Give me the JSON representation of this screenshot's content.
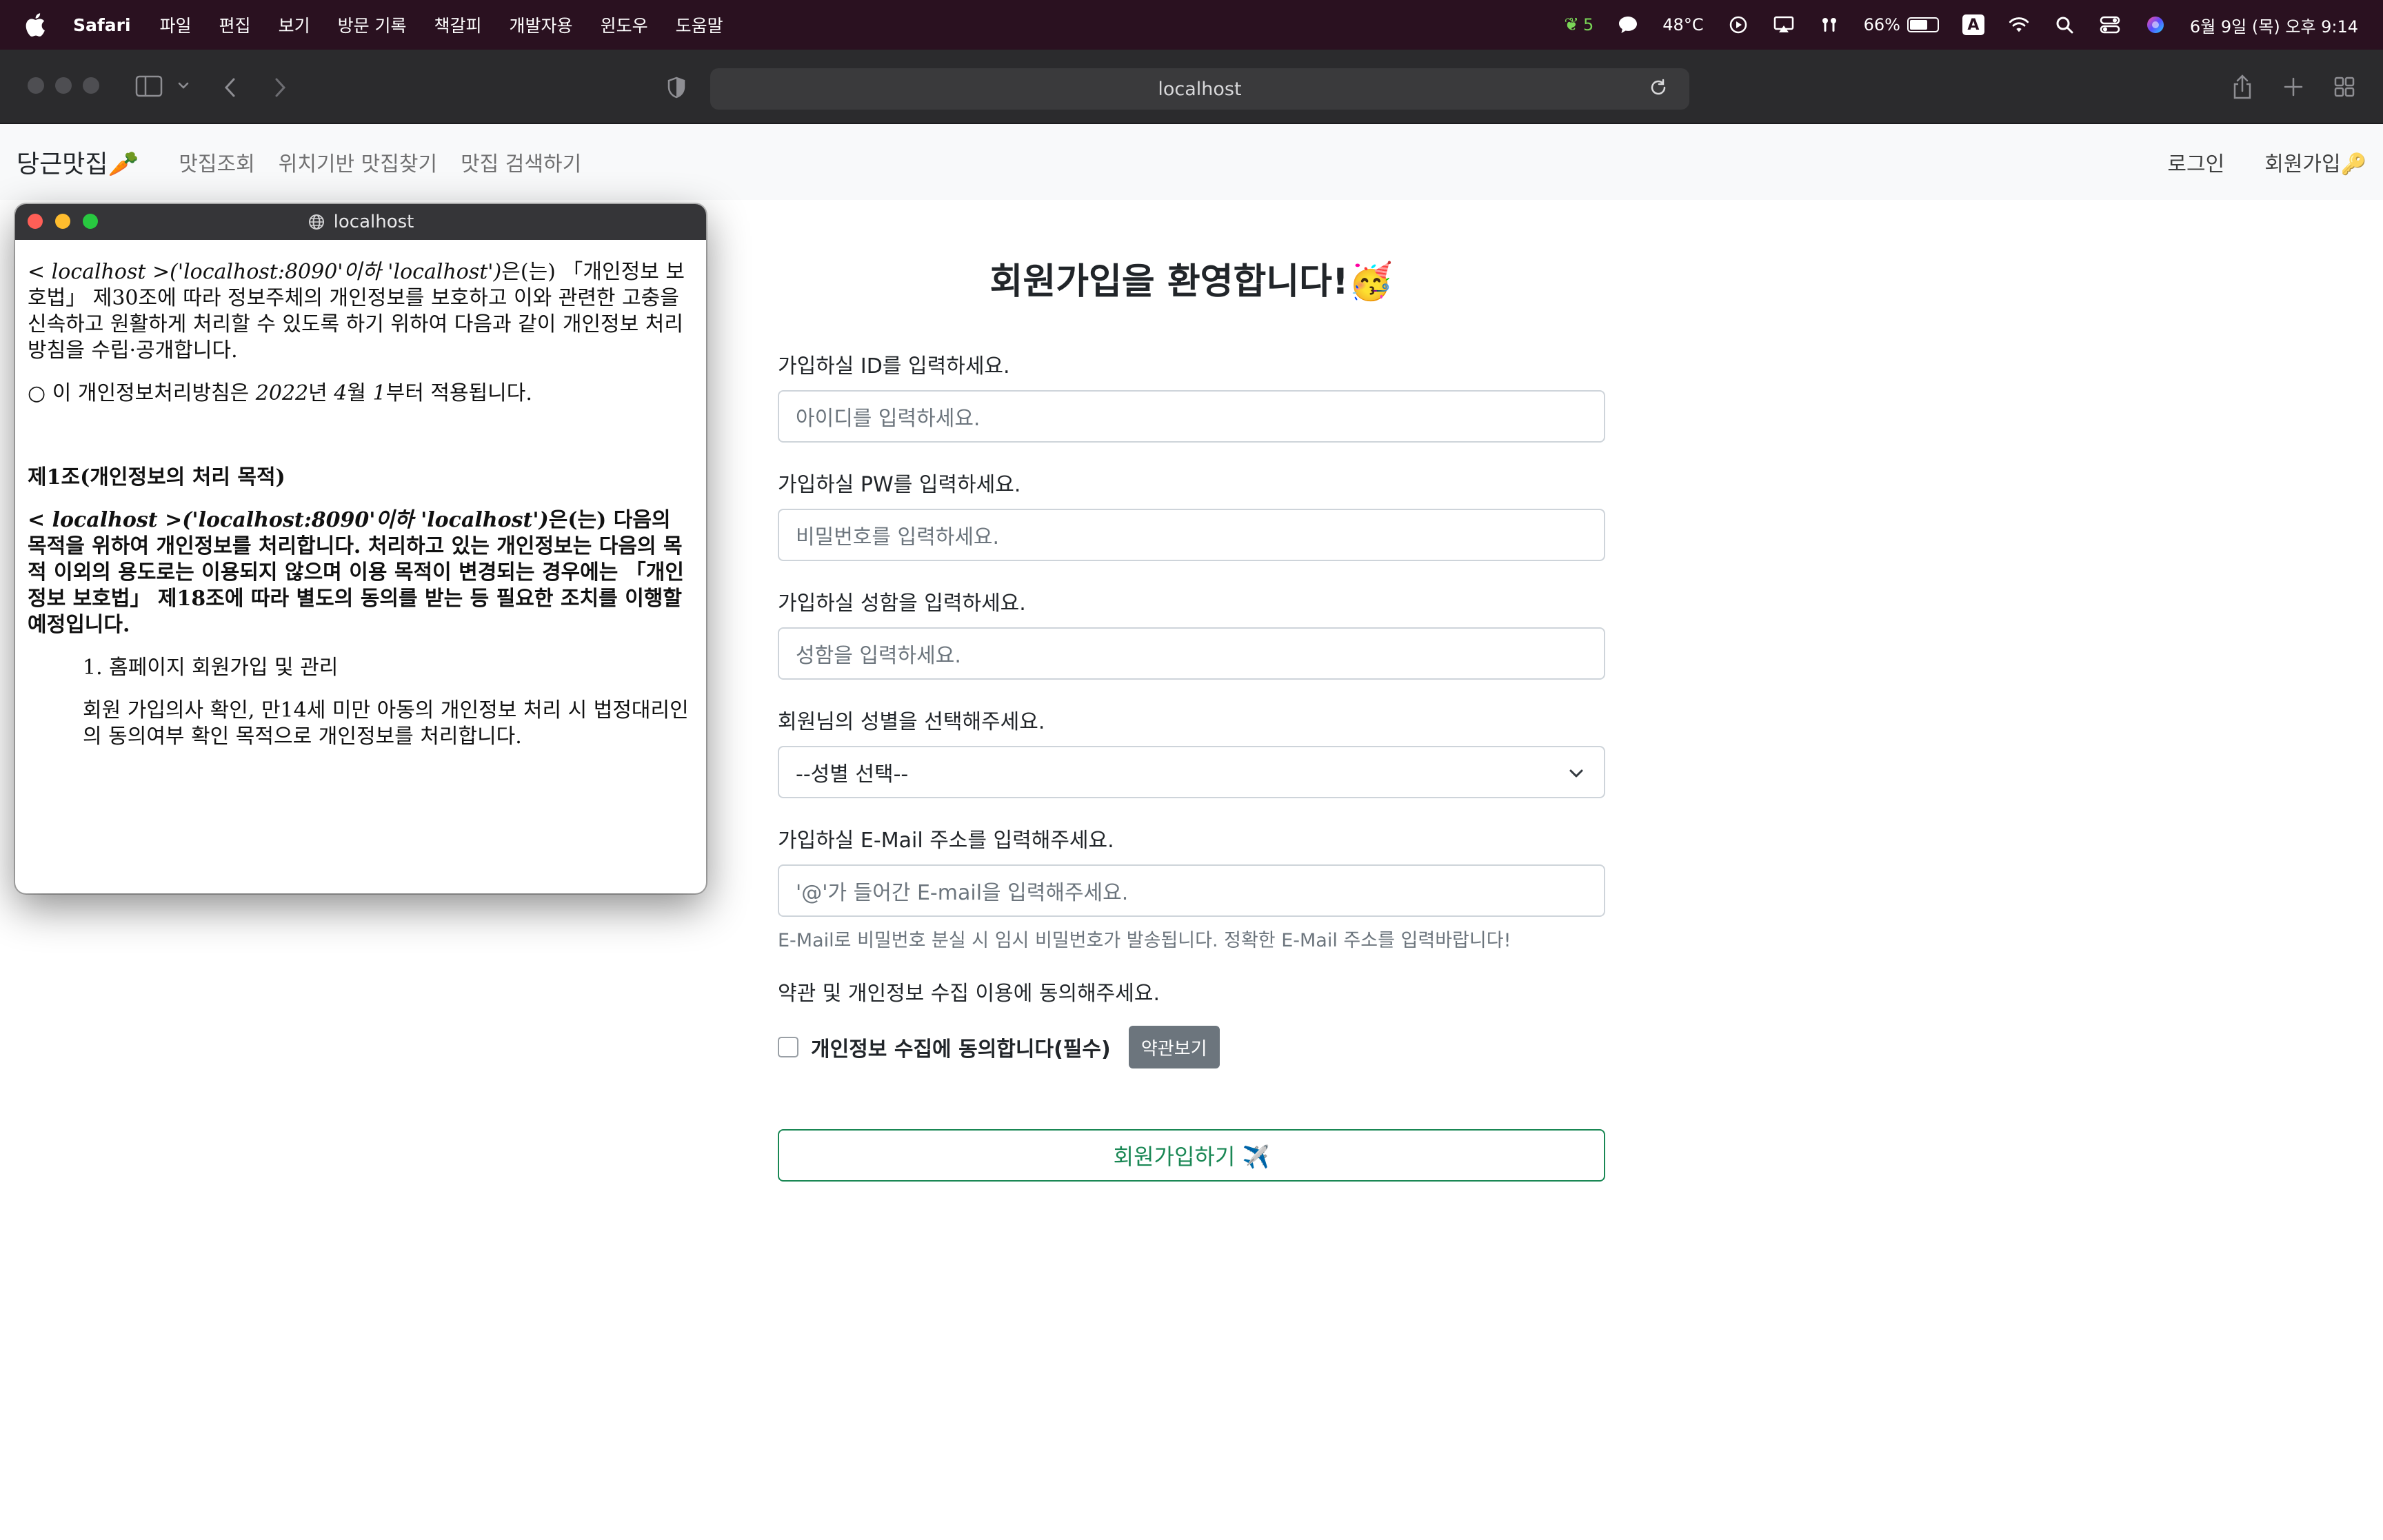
{
  "menubar": {
    "app_name": "Safari",
    "items": [
      "파일",
      "편집",
      "보기",
      "방문 기록",
      "책갈피",
      "개발자용",
      "윈도우",
      "도움말"
    ],
    "status": {
      "leaf_count": "5",
      "temperature": "48°C",
      "battery": "66%",
      "battery_level": 0.66,
      "input_source": "A",
      "datetime": "6월 9일 (목) 오후 9:14"
    }
  },
  "browser": {
    "url": "localhost"
  },
  "nav": {
    "brand": "당근맛집🥕",
    "links": [
      "맛집조회",
      "위치기반 맛집찾기",
      "맛집 검색하기"
    ],
    "login": "로그인",
    "signup": "회원가입🔑"
  },
  "popup": {
    "title": "localhost",
    "p1_italic": "< localhost >('localhost:8090'이하 'localhost')",
    "p1_rest": "은(는) 「개인정보 보호법」 제30조에 따라 정보주체의 개인정보를 보호하고 이와 관련한 고충을 신속하고 원활하게 처리할 수 있도록 하기 위하여 다음과 같이 개인정보 처리방침을 수립·공개합니다.",
    "p2_a": "○ 이 개인정보처리방침은 ",
    "p2_year": "2022",
    "p2_b": "년 ",
    "p2_month": "4",
    "p2_c": "월 ",
    "p2_day": "1",
    "p2_d": "부터 적용됩니다.",
    "section1_title": "제1조(개인정보의 처리 목적)",
    "p3_italic": "< localhost >('localhost:8090'이하 'localhost')",
    "p3_rest": "은(는) 다음의 목적을 위하여 개인정보를 처리합니다. 처리하고 있는 개인정보는 다음의 목적 이외의 용도로는 이용되지 않으며 이용 목적이 변경되는 경우에는 「개인정보 보호법」 제18조에 따라 별도의 동의를 받는 등 필요한 조치를 이행할 예정입니다.",
    "item1": "1. 홈페이지 회원가입 및 관리",
    "item1_desc": "회원 가입의사 확인, 만14세 미만 아동의 개인정보 처리 시 법정대리인의 동의여부 확인 목적으로 개인정보를 처리합니다."
  },
  "form": {
    "title": "회원가입을 환영합니다!🥳",
    "id_label": "가입하실 ID를 입력하세요.",
    "id_placeholder": "아이디를 입력하세요.",
    "pw_label": "가입하실 PW를 입력하세요.",
    "pw_placeholder": "비밀번호를 입력하세요.",
    "name_label": "가입하실 성함을 입력하세요.",
    "name_placeholder": "성함을 입력하세요.",
    "gender_label": "회원님의 성별을 선택해주세요.",
    "gender_selected": "--성별 선택--",
    "email_label": "가입하실 E-Mail 주소를 입력해주세요.",
    "email_placeholder": "'@'가 들어간 E-mail을 입력해주세요.",
    "email_help": "E-Mail로 비밀번호 분실 시 임시 비밀번호가 발송됩니다. 정확한 E-Mail 주소를 입력바랍니다!",
    "agree_label": "약관 및 개인정보 수집 이용에 동의해주세요.",
    "agree_check": "개인정보 수집에 동의합니다(필수)",
    "terms_button": "약관보기",
    "submit": "회원가입하기 ✈️"
  }
}
